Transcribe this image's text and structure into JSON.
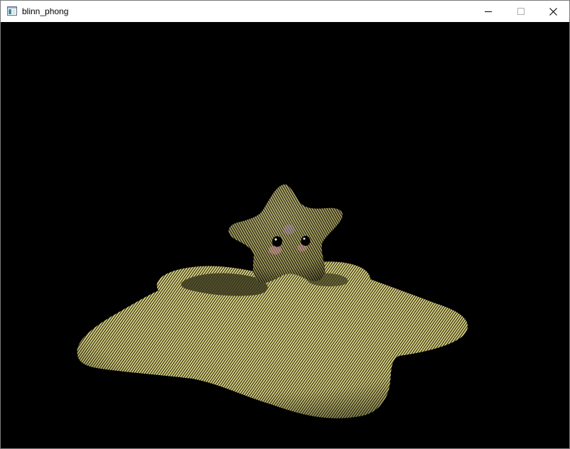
{
  "window": {
    "title": "blinn_phong",
    "icons": {
      "app": "application-icon",
      "minimize": "minimize-icon",
      "maximize": "maximize-icon",
      "close": "close-icon"
    }
  },
  "scene": {
    "background_color": "#000000",
    "model_color": "#e8e08a",
    "model_shadow_color": "#4a4725",
    "eye_color": "#000000",
    "blush_color": "#c98a9a"
  }
}
